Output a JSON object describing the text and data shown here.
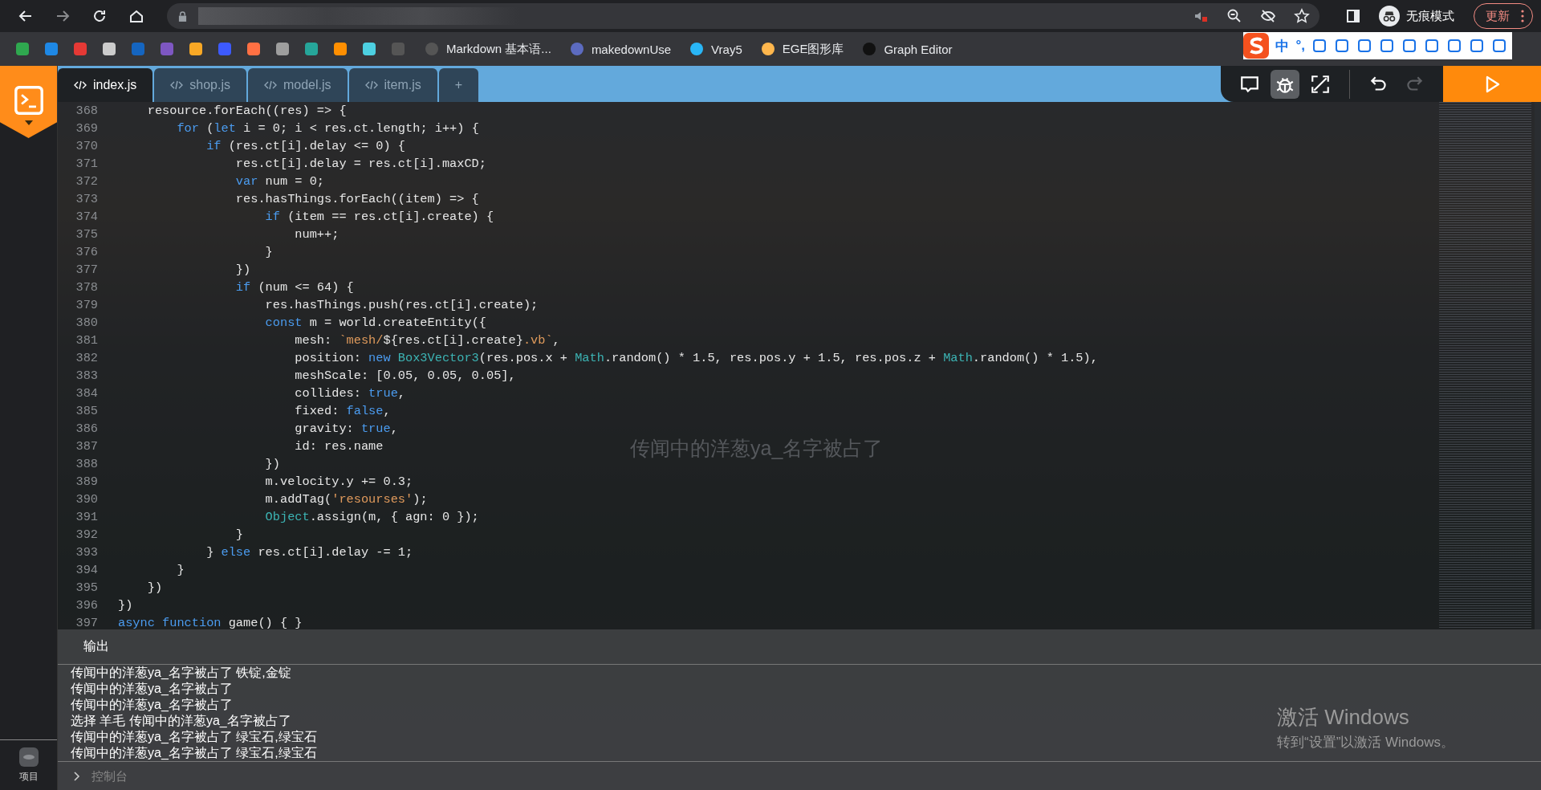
{
  "browser": {
    "incognito_label": "无痕模式",
    "update_button": "更新"
  },
  "bookmarks": [
    {
      "label": "Markdown 基本语..."
    },
    {
      "label": "makedownUse"
    },
    {
      "label": "Vray5"
    },
    {
      "label": "EGE图形库"
    },
    {
      "label": "Graph Editor"
    }
  ],
  "ime_bar": {
    "mode": "中",
    "punct": "°,"
  },
  "tabs": [
    {
      "label": "index.js",
      "selected": true
    },
    {
      "label": "shop.js",
      "selected": false
    },
    {
      "label": "model.js",
      "selected": false
    },
    {
      "label": "item.js",
      "selected": false
    }
  ],
  "add_tab": "+",
  "toolbar": [
    {
      "kind": "comment",
      "selected": false,
      "disabled": false
    },
    {
      "kind": "bug",
      "selected": true,
      "disabled": false
    },
    {
      "kind": "expand",
      "selected": false,
      "disabled": false
    },
    {
      "kind": "undo",
      "selected": false,
      "disabled": false
    },
    {
      "kind": "redo",
      "selected": false,
      "disabled": true
    }
  ],
  "sidebar": {
    "project_label": "项目"
  },
  "code": [
    {
      "number": "368",
      "tokens": [
        {
          "kind": "plain",
          "text": "    resource.forEach((res) => {"
        }
      ]
    },
    {
      "number": "369",
      "tokens": [
        {
          "kind": "keyword",
          "text": "        for"
        },
        {
          "kind": "plain",
          "text": " ("
        },
        {
          "kind": "keyword",
          "text": "let"
        },
        {
          "kind": "plain",
          "text": " i = 0; i < res.ct.length; i++) {"
        }
      ]
    },
    {
      "number": "370",
      "tokens": [
        {
          "kind": "keyword",
          "text": "            if"
        },
        {
          "kind": "plain",
          "text": " (res.ct[i].delay <= 0) {"
        }
      ]
    },
    {
      "number": "371",
      "tokens": [
        {
          "kind": "plain",
          "text": "                res.ct[i].delay = res.ct[i].maxCD;"
        }
      ]
    },
    {
      "number": "372",
      "tokens": [
        {
          "kind": "keyword",
          "text": "                var"
        },
        {
          "kind": "plain",
          "text": " num = 0;"
        }
      ]
    },
    {
      "number": "373",
      "tokens": [
        {
          "kind": "plain",
          "text": "                res.hasThings.forEach((item) => {"
        }
      ]
    },
    {
      "number": "374",
      "tokens": [
        {
          "kind": "keyword",
          "text": "                    if"
        },
        {
          "kind": "plain",
          "text": " (item == res.ct[i].create) {"
        }
      ]
    },
    {
      "number": "375",
      "tokens": [
        {
          "kind": "plain",
          "text": "                        num++;"
        }
      ]
    },
    {
      "number": "376",
      "tokens": [
        {
          "kind": "plain",
          "text": "                    }"
        }
      ]
    },
    {
      "number": "377",
      "tokens": [
        {
          "kind": "plain",
          "text": "                })"
        }
      ]
    },
    {
      "number": "378",
      "tokens": [
        {
          "kind": "keyword",
          "text": "                if"
        },
        {
          "kind": "plain",
          "text": " (num <= 64) {"
        }
      ]
    },
    {
      "number": "379",
      "tokens": [
        {
          "kind": "plain",
          "text": "                    res.hasThings.push(res.ct[i].create);"
        }
      ]
    },
    {
      "number": "380",
      "tokens": [
        {
          "kind": "keyword",
          "text": "                    const"
        },
        {
          "kind": "plain",
          "text": " m = world.createEntity({"
        }
      ]
    },
    {
      "number": "381",
      "tokens": [
        {
          "kind": "plain",
          "text": "                        mesh: "
        },
        {
          "kind": "string",
          "text": "`mesh/"
        },
        {
          "kind": "plain",
          "text": "${res.ct[i].create}"
        },
        {
          "kind": "string",
          "text": ".vb`"
        },
        {
          "kind": "plain",
          "text": ","
        }
      ]
    },
    {
      "number": "382",
      "tokens": [
        {
          "kind": "plain",
          "text": "                        position: "
        },
        {
          "kind": "keyword",
          "text": "new "
        },
        {
          "kind": "type",
          "text": "Box3Vector3"
        },
        {
          "kind": "plain",
          "text": "(res.pos.x + "
        },
        {
          "kind": "type",
          "text": "Math"
        },
        {
          "kind": "plain",
          "text": ".random() * 1.5, res.pos.y + 1.5, res.pos.z + "
        },
        {
          "kind": "type",
          "text": "Math"
        },
        {
          "kind": "plain",
          "text": ".random() * 1.5),"
        }
      ]
    },
    {
      "number": "383",
      "tokens": [
        {
          "kind": "plain",
          "text": "                        meshScale: [0.05, 0.05, 0.05],"
        }
      ]
    },
    {
      "number": "384",
      "tokens": [
        {
          "kind": "plain",
          "text": "                        collides: "
        },
        {
          "kind": "keyword",
          "text": "true"
        },
        {
          "kind": "plain",
          "text": ","
        }
      ]
    },
    {
      "number": "385",
      "tokens": [
        {
          "kind": "plain",
          "text": "                        fixed: "
        },
        {
          "kind": "keyword",
          "text": "false"
        },
        {
          "kind": "plain",
          "text": ","
        }
      ]
    },
    {
      "number": "386",
      "tokens": [
        {
          "kind": "plain",
          "text": "                        gravity: "
        },
        {
          "kind": "keyword",
          "text": "true"
        },
        {
          "kind": "plain",
          "text": ","
        }
      ]
    },
    {
      "number": "387",
      "tokens": [
        {
          "kind": "plain",
          "text": "                        id: res.name"
        }
      ]
    },
    {
      "number": "388",
      "tokens": [
        {
          "kind": "plain",
          "text": "                    })"
        }
      ]
    },
    {
      "number": "389",
      "tokens": [
        {
          "kind": "plain",
          "text": "                    m.velocity.y += 0.3;"
        }
      ]
    },
    {
      "number": "390",
      "tokens": [
        {
          "kind": "plain",
          "text": "                    m.addTag("
        },
        {
          "kind": "string",
          "text": "'resourses'"
        },
        {
          "kind": "plain",
          "text": ");"
        }
      ]
    },
    {
      "number": "391",
      "tokens": [
        {
          "kind": "type",
          "text": "                    Object"
        },
        {
          "kind": "plain",
          "text": ".assign(m, { agn: 0 });"
        }
      ]
    },
    {
      "number": "392",
      "tokens": [
        {
          "kind": "plain",
          "text": "                }"
        }
      ]
    },
    {
      "number": "393",
      "tokens": [
        {
          "kind": "plain",
          "text": "            } "
        },
        {
          "kind": "keyword",
          "text": "else"
        },
        {
          "kind": "plain",
          "text": " res.ct[i].delay -= 1;"
        }
      ]
    },
    {
      "number": "394",
      "tokens": [
        {
          "kind": "plain",
          "text": "        }"
        }
      ]
    },
    {
      "number": "395",
      "tokens": [
        {
          "kind": "plain",
          "text": "    })"
        }
      ]
    },
    {
      "number": "396",
      "tokens": [
        {
          "kind": "plain",
          "text": "})"
        }
      ]
    },
    {
      "number": "397",
      "tokens": [
        {
          "kind": "keyword",
          "text": "async function"
        },
        {
          "kind": "plain",
          "text": " game() { }"
        }
      ]
    }
  ],
  "game_nametag": "传闻中的洋葱ya_名字被占了",
  "output": {
    "title": "输出",
    "lines": [
      "传闻中的洋葱ya_名字被占了 铁锭,金锭",
      "传闻中的洋葱ya_名字被占了",
      "传闻中的洋葱ya_名字被占了",
      "选择 羊毛 传闻中的洋葱ya_名字被占了",
      "传闻中的洋葱ya_名字被占了 绿宝石,绿宝石",
      "传闻中的洋葱ya_名字被占了 绿宝石,绿宝石"
    ],
    "console_placeholder": "控制台"
  },
  "activation_notice": {
    "title": "激活 Windows",
    "subtitle": "转到“设置”以激活 Windows。"
  }
}
